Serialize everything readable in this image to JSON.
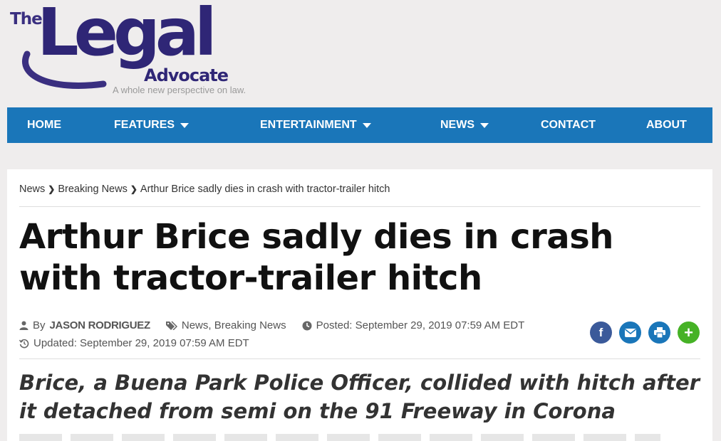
{
  "logo": {
    "the": "The",
    "legal": "Legal",
    "advocate": "Advocate",
    "tagline": "A whole new perspective on law."
  },
  "nav": {
    "items": [
      {
        "label": "HOME",
        "dropdown": false
      },
      {
        "label": "FEATURES",
        "dropdown": true
      },
      {
        "label": "ENTERTAINMENT",
        "dropdown": true
      },
      {
        "label": "NEWS",
        "dropdown": true
      },
      {
        "label": "CONTACT",
        "dropdown": false
      },
      {
        "label": "ABOUT",
        "dropdown": false
      }
    ]
  },
  "breadcrumb": {
    "items": [
      "News",
      "Breaking News",
      "Arthur Brice sadly dies in crash with tractor-trailer hitch"
    ]
  },
  "article": {
    "headline": "Arthur Brice sadly dies in crash with tractor-trailer hitch",
    "by": "By",
    "author": "JASON RODRIGUEZ",
    "categories": "News, Breaking News",
    "posted": "Posted: September 29, 2019 07:59 AM EDT",
    "updated": "Updated: September 29, 2019 07:59 AM EDT",
    "subhead": "Brice, a Buena Park Police Officer, collided with hitch after it detached from semi on the 91 Freeway in Corona"
  },
  "colors": {
    "nav_bg": "#1a76b9",
    "logo": "#2f2676",
    "facebook": "#3b5a9a",
    "share_blue": "#1a76b9",
    "plus_green": "#46b226"
  }
}
